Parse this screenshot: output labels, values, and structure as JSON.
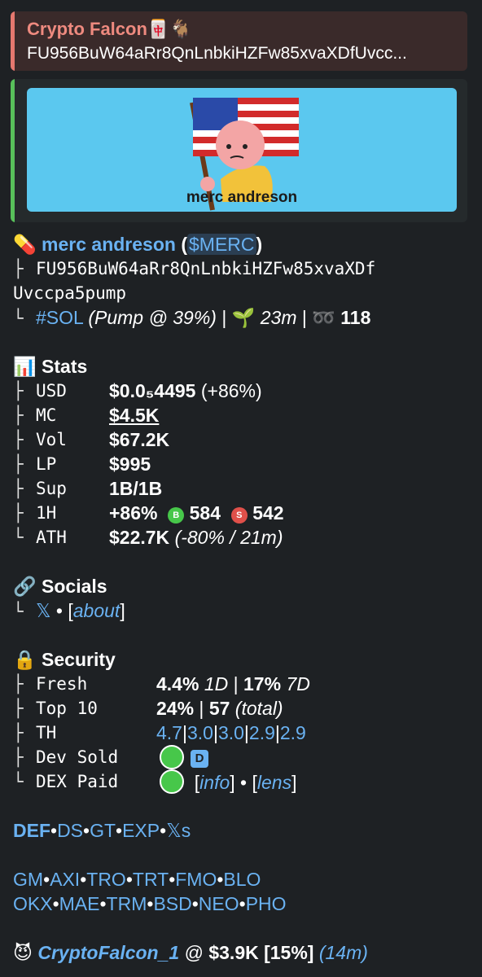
{
  "reply": {
    "name": "Crypto Falcon🀄🐐",
    "address": "FU956BuW64aRr8QnLnbkiHZFw85xvaXDfUvcc..."
  },
  "preview": {
    "caption": "merc andreson"
  },
  "token": {
    "icon": "pill-icon",
    "name": "merc andreson",
    "open_paren": " (",
    "ticker": "$MERC",
    "close_paren": ")",
    "address_line1": "FU956BuW64aRr8QnLnbkiHZFw85xvaXDf",
    "address_line2": "Uvccpa5pump",
    "chain": "#SOL",
    "pump": "(Pump @ 39%)",
    "sep": " | ",
    "age": "23m",
    "holders": "118"
  },
  "stats": {
    "title": "Stats",
    "rows": [
      {
        "label": "USD",
        "value": "$0.0₅4495",
        "extra": " (+86%)"
      },
      {
        "label": "MC",
        "value": "$4.5K"
      },
      {
        "label": "Vol",
        "value": "$67.2K"
      },
      {
        "label": "LP",
        "value": "$995"
      },
      {
        "label": "Sup",
        "value": "1B/1B"
      },
      {
        "label": "1H",
        "value": "+86%",
        "buys": "584",
        "sells": "542"
      },
      {
        "label": "ATH",
        "value": "$22.7K",
        "extra": "(-80% / 21m)"
      }
    ],
    "buy_letter": "B",
    "sell_letter": "S"
  },
  "socials": {
    "title": "Socials",
    "x": "𝕏",
    "dot": " • ",
    "about": "about"
  },
  "security": {
    "title": "Security",
    "fresh_label": "Fresh",
    "fresh_1d": "4.4%",
    "fresh_1d_unit": "1D",
    "fresh_7d": "17%",
    "fresh_7d_unit": "7D",
    "top10_label": "Top 10",
    "top10_pct": "24%",
    "top10_total": "57",
    "top10_total_label": "(total)",
    "th_label": "TH",
    "th_values": [
      "4.7",
      "3.0",
      "3.0",
      "2.9",
      "2.9"
    ],
    "dev_label": "Dev Sold",
    "dev_badge": "D",
    "dex_label": "DEX Paid",
    "info": "info",
    "lens": "lens"
  },
  "links_row1": [
    "DEF",
    "DS",
    "GT",
    "EXP",
    "𝕏s"
  ],
  "links_row2": [
    "GM",
    "AXI",
    "TRO",
    "TRT",
    "FMO",
    "BLO"
  ],
  "links_row3": [
    "OKX",
    "MAE",
    "TRM",
    "BSD",
    "NEO",
    "PHO"
  ],
  "footer": {
    "user": "CryptoFalcon_1",
    "at": " @ ",
    "value": "$3.9K [15%]",
    "time": "(14m)"
  },
  "colors": {
    "background": "#1e2124",
    "link": "#6ab2f2",
    "reply_accent": "#e5786f",
    "preview_accent": "#58c05a",
    "buy": "#47c74a",
    "sell": "#e0504a"
  }
}
